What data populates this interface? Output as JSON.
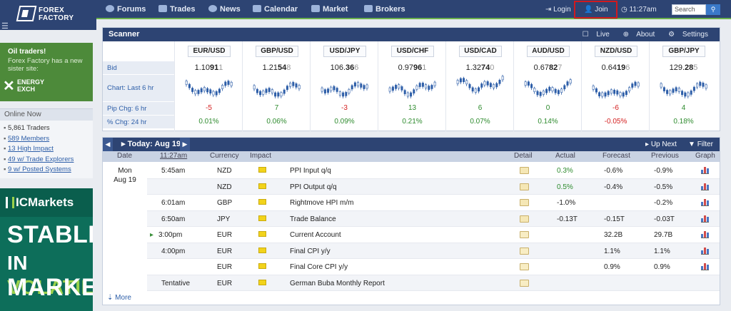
{
  "nav": {
    "logo_line1": "FOREX",
    "logo_line2": "FACTORY",
    "items": [
      "Forums",
      "Trades",
      "News",
      "Calendar",
      "Market",
      "Brokers"
    ],
    "login": "Login",
    "join": "Join",
    "time": "11:27am",
    "search_placeholder": "Search"
  },
  "sidebar": {
    "promo_title": "Oil traders!",
    "promo_text": "Forex Factory has a new sister site:",
    "promo_brand_line1": "ENERGY",
    "promo_brand_line2": "EXCH",
    "online_title": "Online Now",
    "online_items": [
      "5,861 Traders",
      "589 Members",
      "13 High Impact",
      "49 w/ Trade Explorers",
      "9 w/ Posted Systems"
    ],
    "ad_logo": "ICMarkets",
    "ad_line1": "STABLE",
    "ad_line2_a": "IN ",
    "ad_line2_b": "VOLATILE",
    "ad_line3": "MARKETS"
  },
  "scanner": {
    "title": "Scanner",
    "live": "Live",
    "about": "About",
    "settings": "Settings",
    "row_labels": [
      "Bid",
      "Chart: Last 6 hr",
      "Pip Chg: 6 hr",
      "% Chg: 24 hr"
    ],
    "pairs": [
      {
        "name": "EUR/USD",
        "bid_main": "1.10",
        "bid_bold": "91",
        "bid_dim": "1",
        "pip": "-5",
        "pct": "0.01%",
        "pip_dir": "neg",
        "pct_dir": "pos"
      },
      {
        "name": "GBP/USD",
        "bid_main": "1.21",
        "bid_bold": "54",
        "bid_dim": "8",
        "pip": "7",
        "pct": "0.06%",
        "pip_dir": "pos",
        "pct_dir": "pos"
      },
      {
        "name": "USD/JPY",
        "bid_main": "106.",
        "bid_bold": "36",
        "bid_dim": "6",
        "pip": "-3",
        "pct": "0.09%",
        "pip_dir": "neg",
        "pct_dir": "pos"
      },
      {
        "name": "USD/CHF",
        "bid_main": "0.97",
        "bid_bold": "96",
        "bid_dim": "1",
        "pip": "13",
        "pct": "0.21%",
        "pip_dir": "pos",
        "pct_dir": "pos"
      },
      {
        "name": "USD/CAD",
        "bid_main": "1.32",
        "bid_bold": "74",
        "bid_dim": "0",
        "pip": "6",
        "pct": "0.07%",
        "pip_dir": "pos",
        "pct_dir": "pos"
      },
      {
        "name": "AUD/USD",
        "bid_main": "0.67",
        "bid_bold": "82",
        "bid_dim": "7",
        "pip": "0",
        "pct": "0.14%",
        "pip_dir": "pos",
        "pct_dir": "pos"
      },
      {
        "name": "NZD/USD",
        "bid_main": "0.64",
        "bid_bold": "19",
        "bid_dim": "6",
        "pip": "-6",
        "pct": "-0.05%",
        "pip_dir": "neg",
        "pct_dir": "neg"
      },
      {
        "name": "GBP/JPY",
        "bid_main": "129.",
        "bid_bold": "28",
        "bid_dim": "5",
        "pip": "4",
        "pct": "0.18%",
        "pip_dir": "pos",
        "pct_dir": "pos"
      }
    ]
  },
  "calendar": {
    "today_label": "Today: Aug 19",
    "up_next": "Up Next",
    "filter": "Filter",
    "columns": {
      "date": "Date",
      "time": "11:27am",
      "currency": "Currency",
      "impact": "Impact",
      "detail": "Detail",
      "actual": "Actual",
      "forecast": "Forecast",
      "previous": "Previous",
      "graph": "Graph"
    },
    "date_line1": "Mon",
    "date_line2": "Aug 19",
    "more": "More",
    "rows": [
      {
        "time": "5:45am",
        "currency": "NZD",
        "event": "PPI Input q/q",
        "actual": "0.3%",
        "actual_dir": "pos",
        "forecast": "-0.6%",
        "previous": "-0.9%",
        "detail_open": true
      },
      {
        "time": "",
        "currency": "NZD",
        "event": "PPI Output q/q",
        "actual": "0.5%",
        "actual_dir": "pos",
        "forecast": "-0.4%",
        "previous": "-0.5%",
        "detail_open": true
      },
      {
        "time": "6:01am",
        "currency": "GBP",
        "event": "Rightmove HPI m/m",
        "actual": "-1.0%",
        "actual_dir": "",
        "forecast": "",
        "previous": "-0.2%",
        "detail_open": true
      },
      {
        "time": "6:50am",
        "currency": "JPY",
        "event": "Trade Balance",
        "actual": "-0.13T",
        "actual_dir": "",
        "forecast": "-0.15T",
        "previous": "-0.03T",
        "detail_open": true
      },
      {
        "time": "3:00pm",
        "currency": "EUR",
        "event": "Current Account",
        "actual": "",
        "actual_dir": "",
        "forecast": "32.2B",
        "previous": "29.7B",
        "detail_open": false
      },
      {
        "time": "4:00pm",
        "currency": "EUR",
        "event": "Final CPI y/y",
        "actual": "",
        "actual_dir": "",
        "forecast": "1.1%",
        "previous": "1.1%",
        "detail_open": false
      },
      {
        "time": "",
        "currency": "EUR",
        "event": "Final Core CPI y/y",
        "actual": "",
        "actual_dir": "",
        "forecast": "0.9%",
        "previous": "0.9%",
        "detail_open": false
      },
      {
        "time": "Tentative",
        "currency": "EUR",
        "event": "German Buba Monthly Report",
        "actual": "",
        "actual_dir": "",
        "forecast": "",
        "previous": "",
        "detail_open": false
      }
    ]
  }
}
